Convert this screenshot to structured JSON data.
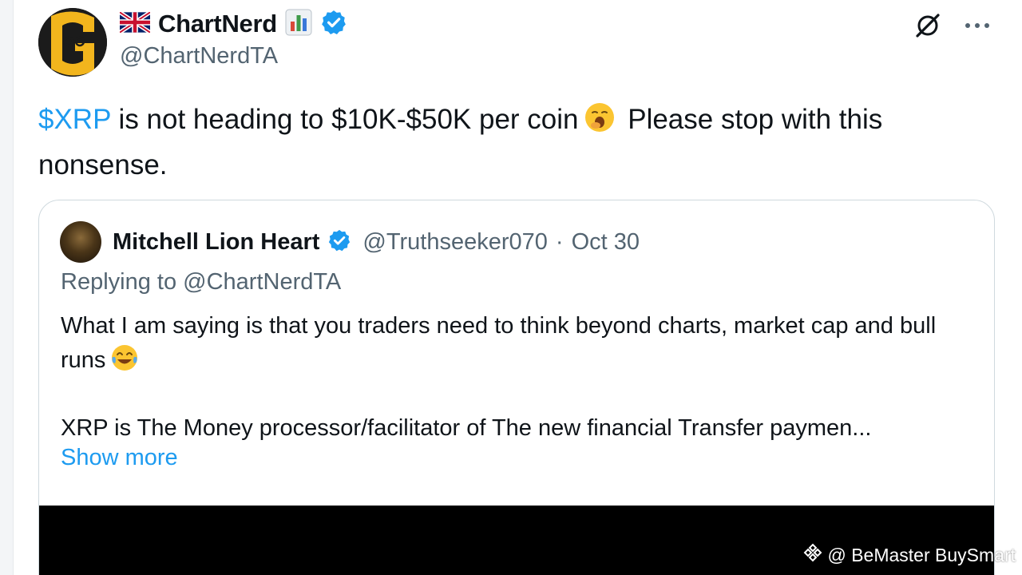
{
  "tweet": {
    "author": {
      "name": "ChartNerd",
      "handle": "@ChartNerdTA",
      "verified": true
    },
    "text": {
      "cashtag": "$XRP",
      "part1": " is not heading to $10K-$50K per coin",
      "part2": " Please stop with this nonsense."
    },
    "icons": {
      "flag": "uk-flag-icon",
      "name_emoji": "bar-chart-icon",
      "verified": "verified-badge-icon",
      "grok": "grok-icon",
      "more": "more-icon",
      "inline_emoji": "yawning-face-icon"
    }
  },
  "quote": {
    "author": {
      "name": "Mitchell Lion Heart",
      "handle": "@Truthseeker070",
      "separator": "·",
      "date": "Oct 30",
      "verified": true
    },
    "replying_to": "Replying to @ChartNerdTA",
    "body_line1": "What I am saying is that you traders need to think beyond charts, market cap and bull runs",
    "body_line2": "XRP is The Money processor/facilitator of The new financial Transfer paymen...",
    "show_more": "Show more",
    "inline_emoji": "tears-of-joy-icon"
  },
  "watermark": {
    "text": "@ BeMaster BuySmart",
    "icon": "binance-logo-icon"
  },
  "colors": {
    "link": "#1d9bf0",
    "secondary_text": "#536471",
    "primary_text": "#0f1419",
    "card_border": "#cfd9de",
    "verified": "#1d9bf0"
  }
}
